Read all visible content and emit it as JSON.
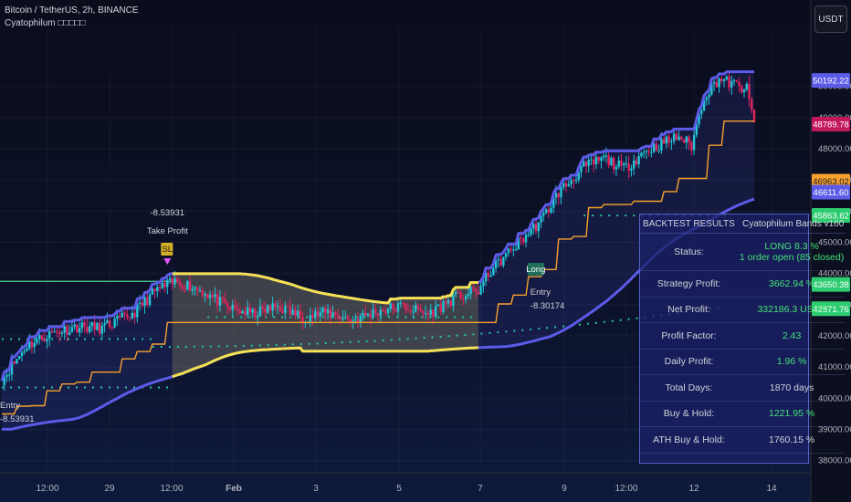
{
  "header": {
    "symbol_line": "Bitcoin / TetherUS, 2h, BINANCE",
    "indicator_line": "Cyatophilum □□□□□"
  },
  "currency_button": "USDT",
  "colors": {
    "band_blue": "#5b5be8",
    "band_yellow": "#f5e050",
    "band_orange": "#f7a12c",
    "dots_green": "#26c6a0",
    "level_line": "#4cd99a",
    "candle_up": "#22c5d6",
    "candle_down": "#e0245e",
    "profit_green": "#44e27a",
    "last_price_red": "#c2185b"
  },
  "chart_data": {
    "type": "candlestick",
    "ylim": [
      37700,
      51600
    ],
    "x_tick_labels": [
      "12:00",
      "29",
      "12:00",
      "Feb",
      "3",
      "5",
      "7",
      "9",
      "12:00",
      "12",
      "14"
    ],
    "y_tick_labels": [
      "50000.00",
      "49000.00",
      "48000.00",
      "47000.00",
      "46000.00",
      "45000.00",
      "44000.00",
      "43000.00",
      "42000.00",
      "41000.00",
      "40000.00",
      "39000.00",
      "38000.00"
    ],
    "price_badges": [
      {
        "text": "50192.22",
        "value": 50192.22,
        "color": "#5b5be8"
      },
      {
        "text": "48789.78",
        "value": 48789.78,
        "color": "#c2185b"
      },
      {
        "text": "46963.02",
        "value": 46963.02,
        "color": "#f7a12c"
      },
      {
        "text": "46611.60",
        "value": 46611.6,
        "color": "#5b5be8"
      },
      {
        "text": "45863.62",
        "value": 45863.62,
        "color": "#2ecc71"
      },
      {
        "text": "43650.38",
        "value": 43650.38,
        "color": "#2ecc71"
      },
      {
        "text": "42871.76",
        "value": 42871.76,
        "color": "#2ecc71"
      }
    ],
    "close_anchors": [
      [
        0,
        40600
      ],
      [
        10,
        41700
      ],
      [
        20,
        42100
      ],
      [
        30,
        42300
      ],
      [
        40,
        42250
      ],
      [
        52,
        42700
      ],
      [
        62,
        43500
      ],
      [
        70,
        43750
      ],
      [
        80,
        43450
      ],
      [
        90,
        42900
      ],
      [
        100,
        42700
      ],
      [
        110,
        42950
      ],
      [
        120,
        42600
      ],
      [
        130,
        42750
      ],
      [
        140,
        42500
      ],
      [
        150,
        42800
      ],
      [
        160,
        42950
      ],
      [
        170,
        42700
      ],
      [
        180,
        43200
      ],
      [
        190,
        43450
      ],
      [
        195,
        44100
      ],
      [
        205,
        44900
      ],
      [
        215,
        45700
      ],
      [
        222,
        46600
      ],
      [
        232,
        47400
      ],
      [
        240,
        47700
      ],
      [
        248,
        47350
      ],
      [
        256,
        47900
      ],
      [
        264,
        48200
      ],
      [
        270,
        48400
      ],
      [
        275,
        48100
      ],
      [
        280,
        49700
      ],
      [
        286,
        50250
      ],
      [
        292,
        50050
      ],
      [
        297,
        49900
      ],
      [
        300,
        48790
      ]
    ],
    "annotations": [
      {
        "kind": "take-profit",
        "value_label": "-8.53931",
        "text": "Take Profit"
      },
      {
        "kind": "entry",
        "text": "Entry",
        "value_label": "-8.30174"
      },
      {
        "kind": "entry",
        "text": "Entry",
        "value_label": "-8.53931"
      }
    ],
    "marker_labels": [
      "SL",
      "Long"
    ]
  },
  "backtest": {
    "title": "BACKTEST RESULTS",
    "subtitle": "Cyatophilum Bands v160",
    "rows": [
      {
        "label": "Status:",
        "value": "LONG 8.3 %",
        "value2": "1 order open (85 closed)",
        "color": "#44e27a"
      },
      {
        "label": "Strategy Profit:",
        "value": "3662.94 %",
        "color": "#44e27a"
      },
      {
        "label": "Net Profit:",
        "value": "332186.3 USDT",
        "color": "#44e27a"
      },
      {
        "label": "Profit Factor:",
        "value": "2.43",
        "color": "#44e27a"
      },
      {
        "label": "Daily Profit:",
        "value": "1.96 %",
        "color": "#44e27a"
      },
      {
        "label": "Total Days:",
        "value": "1870 days",
        "color": "#d1d4dc"
      },
      {
        "label": "Buy & Hold:",
        "value": "1221.95 %",
        "color": "#44e27a"
      },
      {
        "label": "ATH Buy & Hold:",
        "value": "1760.15 %",
        "color": "#d1d4dc"
      }
    ]
  }
}
